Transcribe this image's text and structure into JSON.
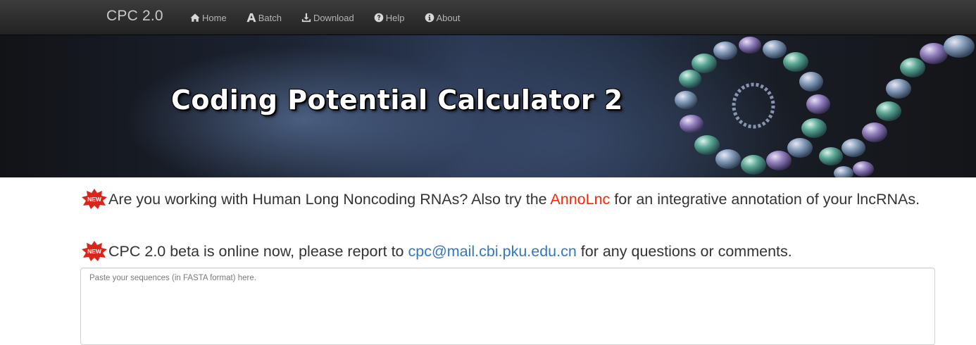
{
  "navbar": {
    "brand": "CPC 2.0",
    "items": [
      {
        "label": "Home",
        "icon": "home-icon"
      },
      {
        "label": "Batch",
        "icon": "batch-icon"
      },
      {
        "label": "Download",
        "icon": "download-icon"
      },
      {
        "label": "Help",
        "icon": "help-icon"
      },
      {
        "label": "About",
        "icon": "info-icon"
      }
    ]
  },
  "banner": {
    "title": "Coding Potential Calculator 2"
  },
  "notices": {
    "first": {
      "text_before": "Are you working with Human Long Noncoding RNAs? Also try the ",
      "link": "AnnoLnc",
      "text_after": " for an integrative annotation of your lncRNAs."
    },
    "second": {
      "text_before": "CPC 2.0 beta is online now, please report to ",
      "link": "cpc@mail.cbi.pku.edu.cn",
      "text_after": " for any questions or comments."
    },
    "badge_icon": "new-badge-icon"
  },
  "sequence_input": {
    "placeholder": "Paste your sequences (in FASTA format) here.",
    "value": ""
  },
  "colors": {
    "navbar_bg": "#222222",
    "link_red": "#ff2200",
    "link_blue": "#3278c0"
  }
}
